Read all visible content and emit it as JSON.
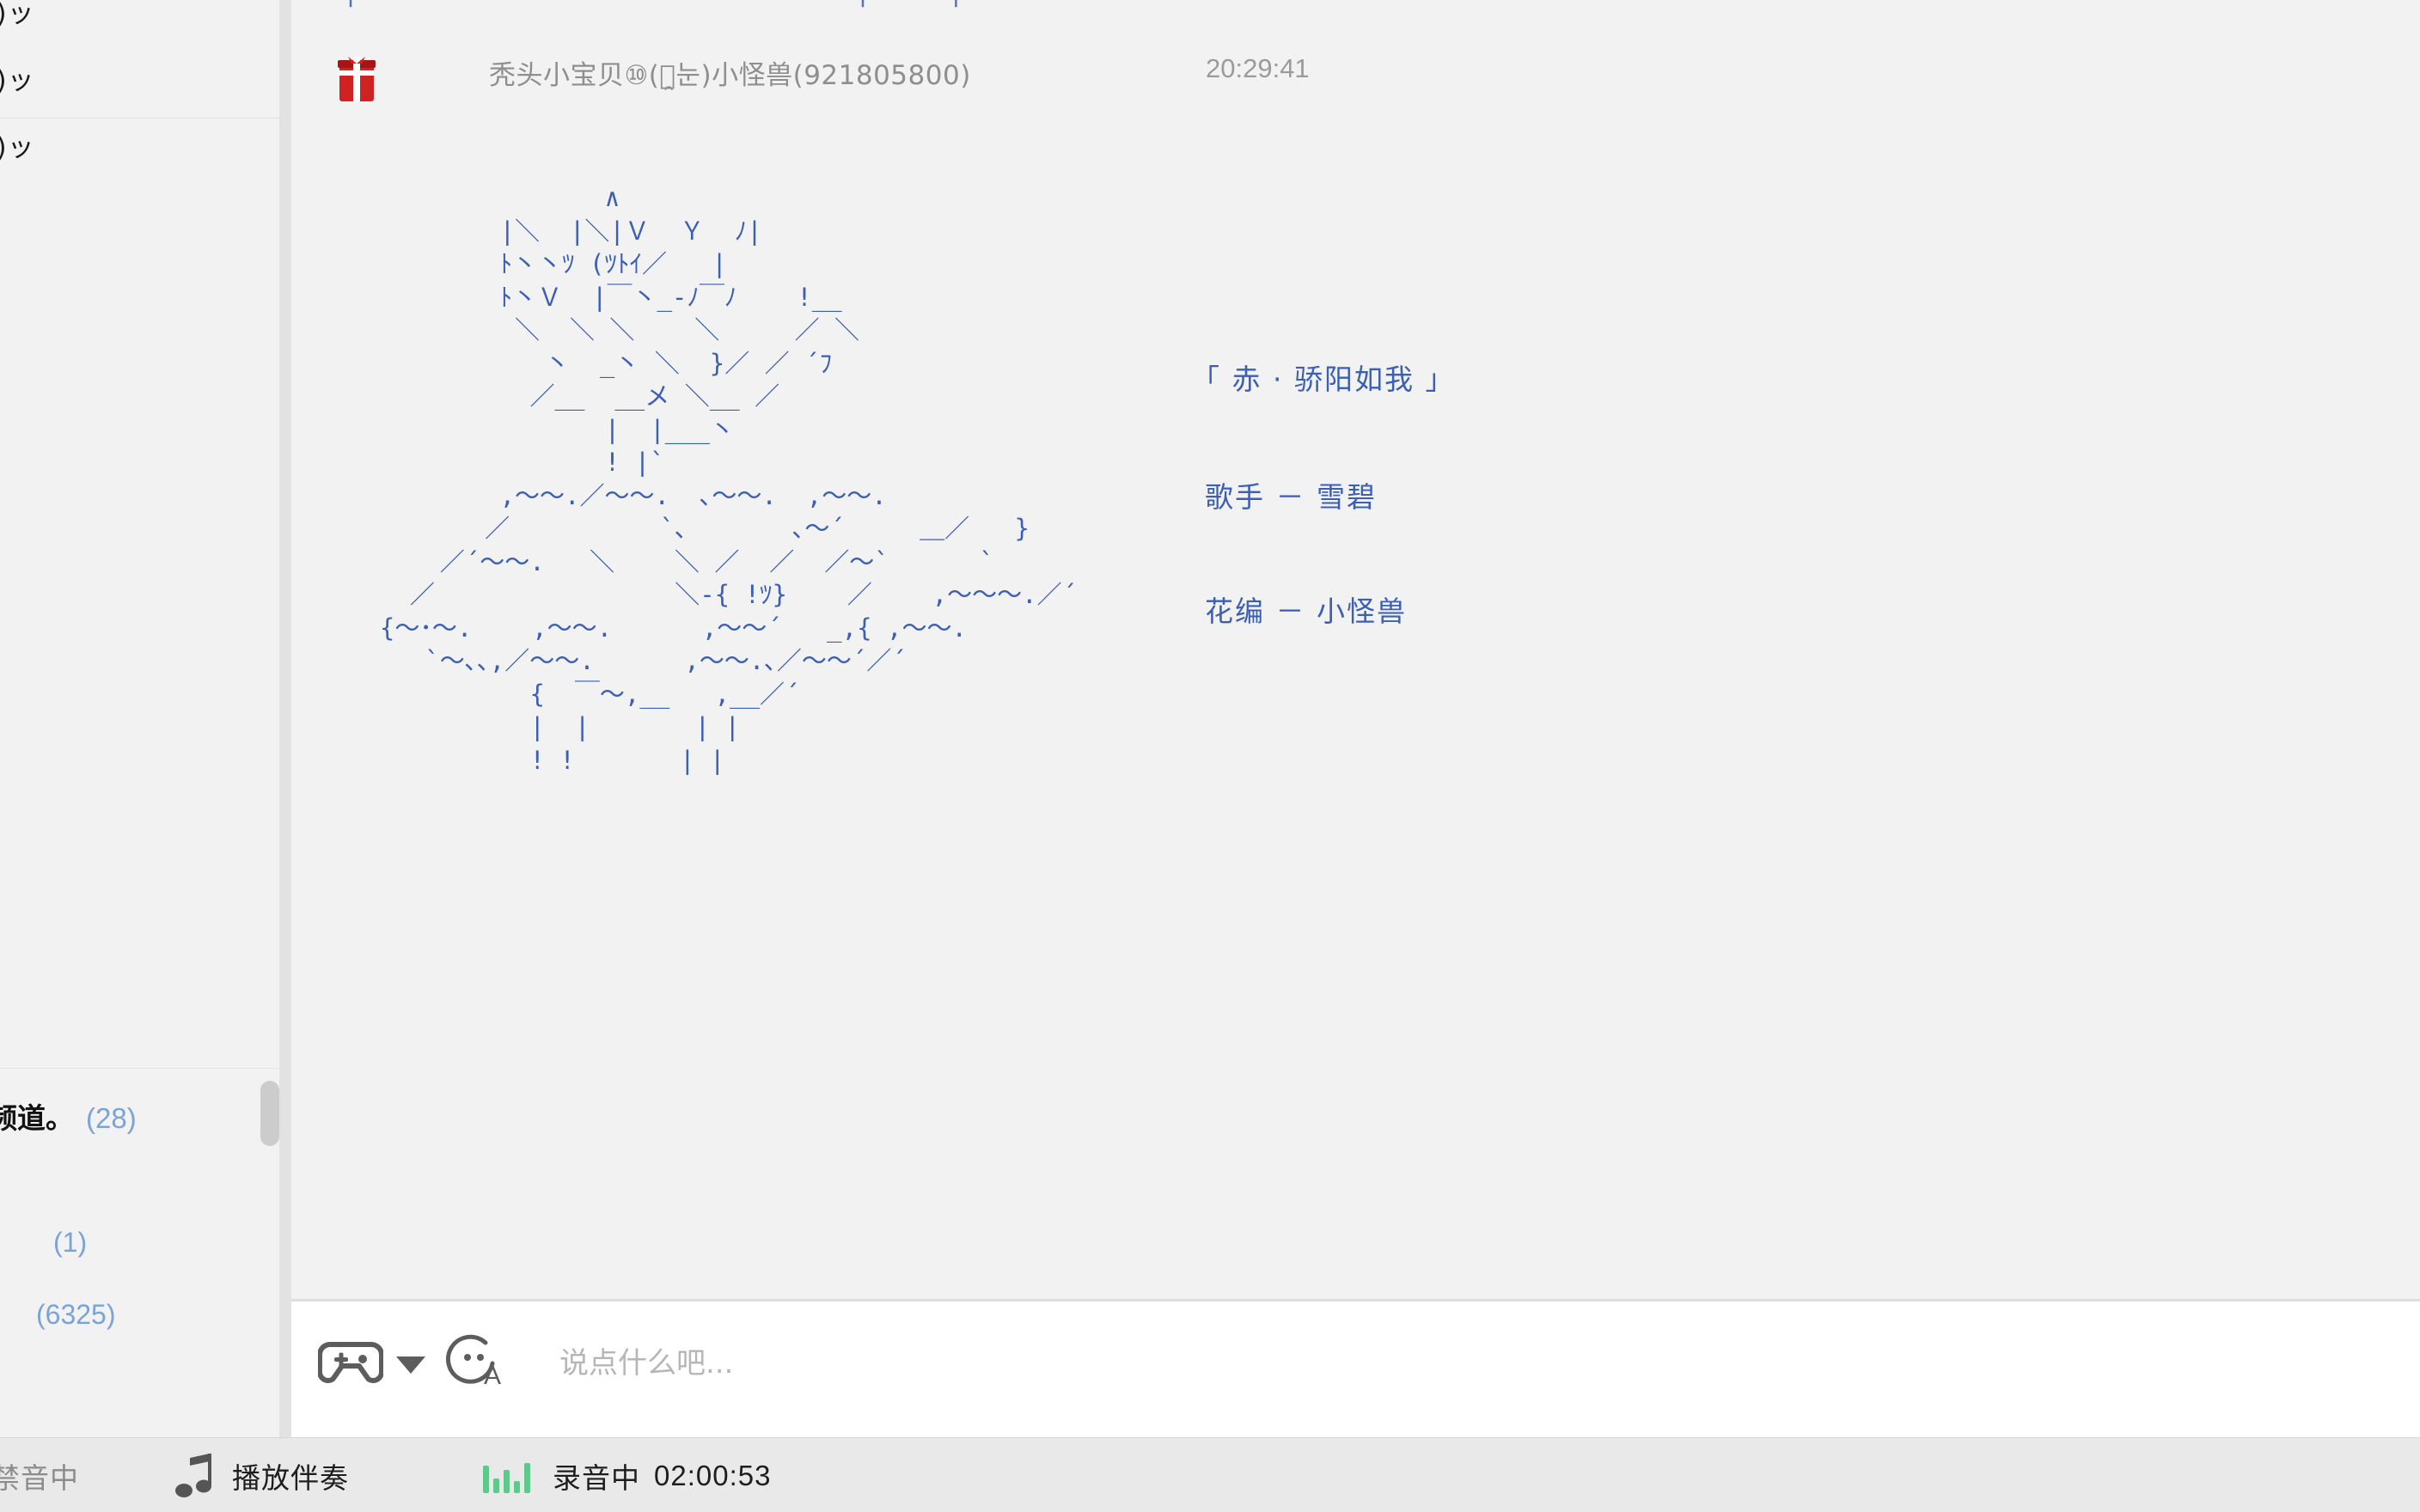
{
  "sidebar": {
    "clipped_rows": [
      "ᗒ￣)ッ",
      "ᗒ￣)ッ",
      "ᗒ￣)ッ"
    ],
    "channel": {
      "name": "乐频道。",
      "count": "(28)"
    },
    "numbers": [
      "(1)",
      "(6325)"
    ],
    "scrollbar": "vertical-scrollbar"
  },
  "chat": {
    "previous_message_clipped": "|         ·                      |     |",
    "message": {
      "gift_icon": "gift-icon",
      "sender": "秃头小宝贝⑩(눈̯눈)小怪兽(921805800)",
      "time": "20:29:41",
      "ascii_art": "                 ∧\n          |＼  |＼|Ｖ  Ｙ  ﾉ|\n          ﾄ丶丶ﾂ (ﾂﾄｲ／   |\n          ﾄ丶Ｖ  |￣丶_-ﾉ￣ﾉ    !__\n           ＼  ＼ ＼    ＼     ／ ＼\n             丶  _丶 ＼  }／ ／ ´ﾌ\n            ／__  __メ ＼__ ／\n                 |  |___丶\n                 ! |`\n          ,～～.／～～.  ､～～.  ,～～.\n         ／          `､       ､～´     ＿／   }\n      ／´～～.   ＼    ＼ ／  ／  ／～`      `\n    ／                ＼-{ !ﾂ}    ／    ,～～～.／´\n  {～･～.    ,～～.      ,～～´   _,{ ,～～.\n     `～､､,／～～.      ,～～.､／～～´／´\n            {  ￣～,__   ,__／´\n            |  |       | |\n            ! !       | |",
      "labels": {
        "title": "「 赤 · 骄阳如我 」",
        "singer": "歌手 － 雪碧",
        "editor": "花编 － 小怪兽"
      }
    }
  },
  "input_bar": {
    "gamepad_icon": "gamepad-icon",
    "gamepad_dropdown_icon": "chevron-down-icon",
    "emoji_icon": "emoji-face-icon",
    "placeholder": "说点什么吧...",
    "value": ""
  },
  "status_bar": {
    "mute_label": "禁音中",
    "music_note_icon": "music-note-icon",
    "accompaniment_label": "播放伴奏",
    "waveform_icon": "waveform-icon",
    "recording_label": "录音中",
    "recording_time": "02:00:53"
  },
  "colors": {
    "ascii_blue": "#3b5fb5",
    "link_blue": "#7aa3d8",
    "panel_bg": "#f2f2f2",
    "input_bg": "#ffffff",
    "status_bg": "#e9e9e9",
    "gift_red": "#cf2222",
    "wave_green": "#5ec98a"
  }
}
